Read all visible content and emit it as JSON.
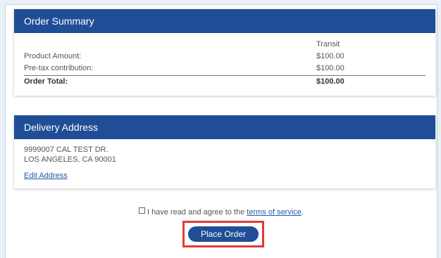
{
  "order_summary": {
    "title": "Order Summary",
    "column_header": "Transit",
    "rows": [
      {
        "label": "Product Amount:",
        "value": "$100.00"
      },
      {
        "label": "Pre-tax contribution:",
        "value": "$100.00"
      }
    ],
    "total": {
      "label": "Order Total:",
      "value": "$100.00"
    }
  },
  "delivery": {
    "title": "Delivery Address",
    "address_line1": "9999007 CAL TEST DR.",
    "address_line2": "LOS ANGELES, CA 90001",
    "edit_label": "Edit Address"
  },
  "agreement": {
    "text": "I have read and agree to the ",
    "terms_label": "terms of service",
    "period": ".",
    "checked": false
  },
  "place_order_label": "Place Order",
  "colors": {
    "header": "#1f4e96",
    "link": "#1f5aa8",
    "highlight": "#e03b3b",
    "background": "#e8f1f8"
  }
}
